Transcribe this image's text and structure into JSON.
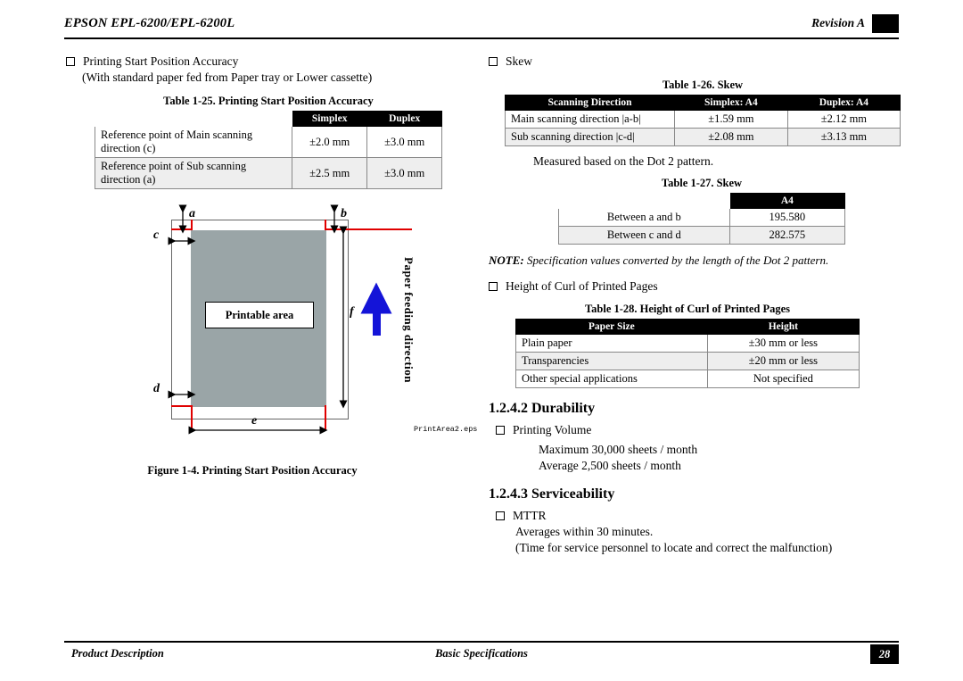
{
  "header": {
    "title": "EPSON EPL-6200/EPL-6200L",
    "revision": "Revision A"
  },
  "footer": {
    "left": "Product Description",
    "center": "Basic Specifications",
    "page": "28"
  },
  "left": {
    "item1": "Printing Start Position Accuracy",
    "item1_sub": "(With standard paper fed from Paper tray or Lower cassette)",
    "table25": {
      "caption": "Table 1-25.  Printing Start Position Accuracy",
      "headers": [
        "",
        "Simplex",
        "Duplex"
      ],
      "rows": [
        [
          "Reference point of Main scanning direction (c)",
          "±2.0 mm",
          "±3.0 mm"
        ],
        [
          "Reference point of Sub scanning direction (a)",
          "±2.5 mm",
          "±3.0 mm"
        ]
      ]
    },
    "figure": {
      "label_a": "a",
      "label_b": "b",
      "label_c": "c",
      "label_d": "d",
      "label_e": "e",
      "label_f": "f",
      "printable_area": "Printable area",
      "feed_direction": "Paper feeding direction",
      "eps_name": "PrintArea2.eps",
      "caption": "Figure 1-4.  Printing Start Position Accuracy"
    }
  },
  "right": {
    "item_skew": "Skew",
    "table26": {
      "caption": "Table 1-26.  Skew",
      "headers": [
        "Scanning Direction",
        "Simplex: A4",
        "Duplex: A4"
      ],
      "rows": [
        [
          "Main scanning direction |a-b|",
          "±1.59 mm",
          "±2.12 mm"
        ],
        [
          "Sub scanning direction |c-d|",
          "±2.08 mm",
          "±3.13 mm"
        ]
      ]
    },
    "measured_note": "Measured based on the Dot 2 pattern.",
    "table27": {
      "caption": "Table 1-27.  Skew",
      "headers": [
        "",
        "A4"
      ],
      "rows": [
        [
          "Between a and b",
          "195.580"
        ],
        [
          "Between c and d",
          "282.575"
        ]
      ]
    },
    "note": {
      "prefix": "NOTE:",
      "text": "Specification values converted by the length of the Dot 2 pattern."
    },
    "item_curl": "Height of Curl of Printed Pages",
    "table28": {
      "caption": "Table 1-28.  Height of Curl of Printed Pages",
      "headers": [
        "Paper Size",
        "Height"
      ],
      "rows": [
        [
          "Plain paper",
          "±30 mm or less"
        ],
        [
          "Transparencies",
          "±20 mm or less"
        ],
        [
          "Other special applications",
          "Not specified"
        ]
      ]
    },
    "durability": {
      "heading": "1.2.4.2  Durability",
      "item": "Printing Volume",
      "line1": "Maximum 30,000 sheets / month",
      "line2": "Average 2,500 sheets / month"
    },
    "serviceability": {
      "heading": "1.2.4.3  Serviceability",
      "item": "MTTR",
      "line1": "Averages within 30 minutes.",
      "line2": "(Time for service personnel to locate and correct the malfunction)"
    }
  }
}
